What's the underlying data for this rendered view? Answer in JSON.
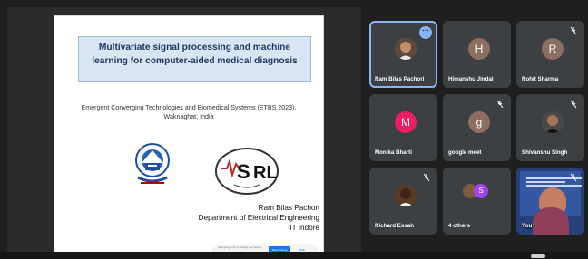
{
  "presentation": {
    "title_line1": "Multivariate signal processing and machine",
    "title_line2": "learning for computer-aided medical diagnosis",
    "conference_line1": "Emergent Converging Technologies and Biomedical Systems (ETBS 2023),",
    "conference_line2": "Waknaghat, India",
    "author_name": "Ram Bilas Pachori",
    "author_department": "Department of Electrical Engineering",
    "author_institute": "IIT Indore",
    "logo_left_text": "",
    "logo_right_text": "S RL",
    "share_notice": "meet.google.com is sharing your screen.",
    "stop_sharing_label": "Stop sharing",
    "hide_label": "Hide"
  },
  "participants": [
    {
      "name": "Ram Bilas Pachori",
      "avatar": "photo",
      "muted": false,
      "selected": true,
      "more": true
    },
    {
      "name": "Himanshu Jindal",
      "avatar": "H",
      "color": "#8d6e63",
      "muted": false
    },
    {
      "name": "Rohit Sharma",
      "avatar": "R",
      "color": "#8d6e63",
      "muted": true
    },
    {
      "name": "Monika Bharti",
      "avatar": "M",
      "color": "#e91e63",
      "muted": false
    },
    {
      "name": "google meet",
      "avatar": "g",
      "color": "#8d6e63",
      "muted": true
    },
    {
      "name": "Shivanshu Singh",
      "avatar": "photo",
      "muted": true
    },
    {
      "name": "Richard Essah",
      "avatar": "photo",
      "muted": true
    },
    {
      "name": "4 others",
      "avatar": "group",
      "muted": false
    },
    {
      "name": "You",
      "avatar": "video",
      "muted": true
    }
  ],
  "colors": {
    "meet_dark": "#202124",
    "tile": "#3c4043",
    "selected": "#8ab4f8",
    "title_blue": "#1f3864",
    "title_fill": "#d8e6f4"
  },
  "icons": {
    "mute": "microphone-off-icon",
    "more": "more-options-icon",
    "stop": "stop-sharing-button",
    "iit_logo": "iit-indore-logo",
    "sirl_logo": "sirl-logo"
  }
}
